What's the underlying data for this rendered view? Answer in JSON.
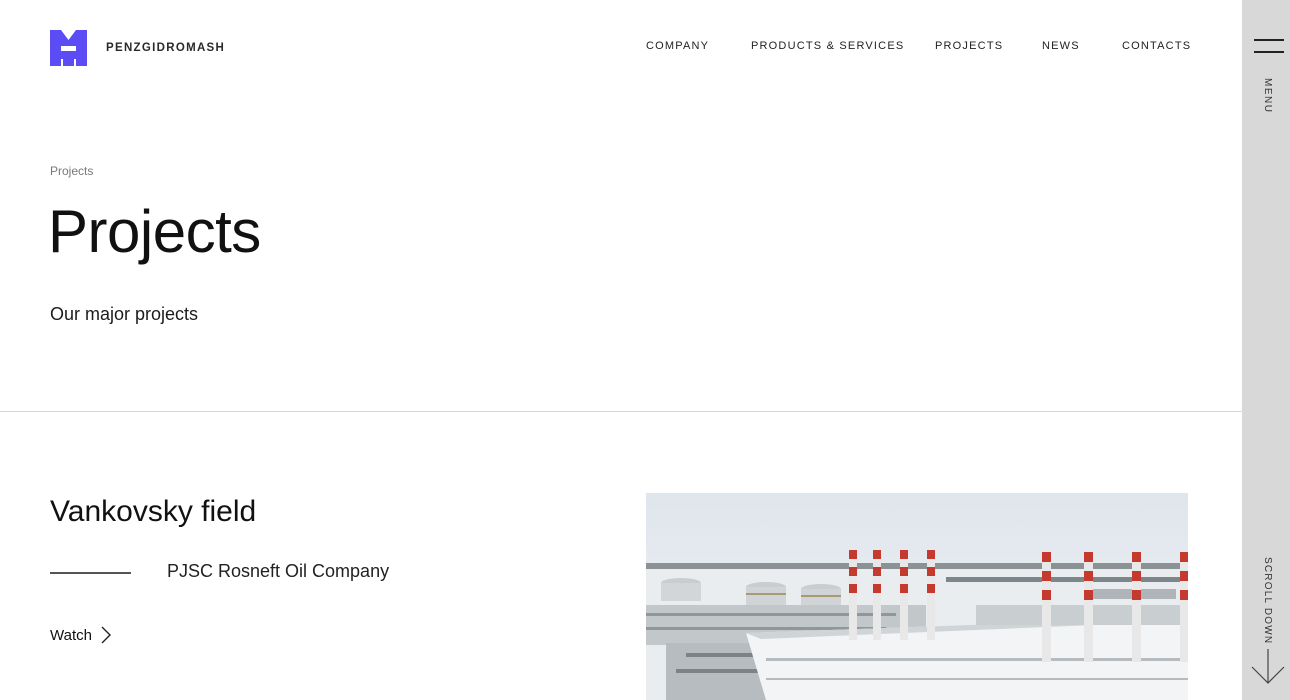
{
  "brand": {
    "name": "PENZGIDROMASH",
    "accent_color": "#5b4cf5"
  },
  "nav": {
    "items": [
      {
        "label": "COMPANY"
      },
      {
        "label": "PRODUCTS & SERVICES"
      },
      {
        "label": "PROJECTS"
      },
      {
        "label": "NEWS"
      },
      {
        "label": "CONTACTS"
      }
    ]
  },
  "breadcrumb": "Projects",
  "page": {
    "title": "Projects",
    "subtitle": "Our major projects"
  },
  "project": {
    "name": "Vankovsky field",
    "client": "PJSC Rosneft Oil Company",
    "watch_label": "Watch",
    "image_icon": "industrial-plant-photo"
  },
  "side_panel": {
    "menu_label": "MENU",
    "scroll_label": "SCROLL DOWN",
    "background": "#d8d8d8"
  }
}
